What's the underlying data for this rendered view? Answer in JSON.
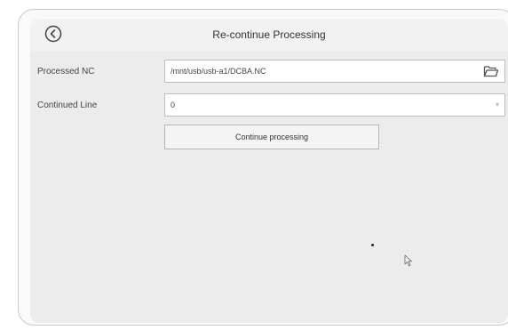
{
  "header": {
    "title": "Re-continue Processing"
  },
  "rows": {
    "processed_nc": {
      "label": "Processed NC",
      "value": "/mnt/usb/usb-a1/DCBA.NC"
    },
    "continued_line": {
      "label": "Continued Line",
      "value": "0"
    }
  },
  "actions": {
    "continue_label": "Continue processing"
  },
  "icons": {
    "back": "back-circle-chevron-icon",
    "folder": "folder-open-icon",
    "cursor": "mouse-pointer-icon"
  }
}
